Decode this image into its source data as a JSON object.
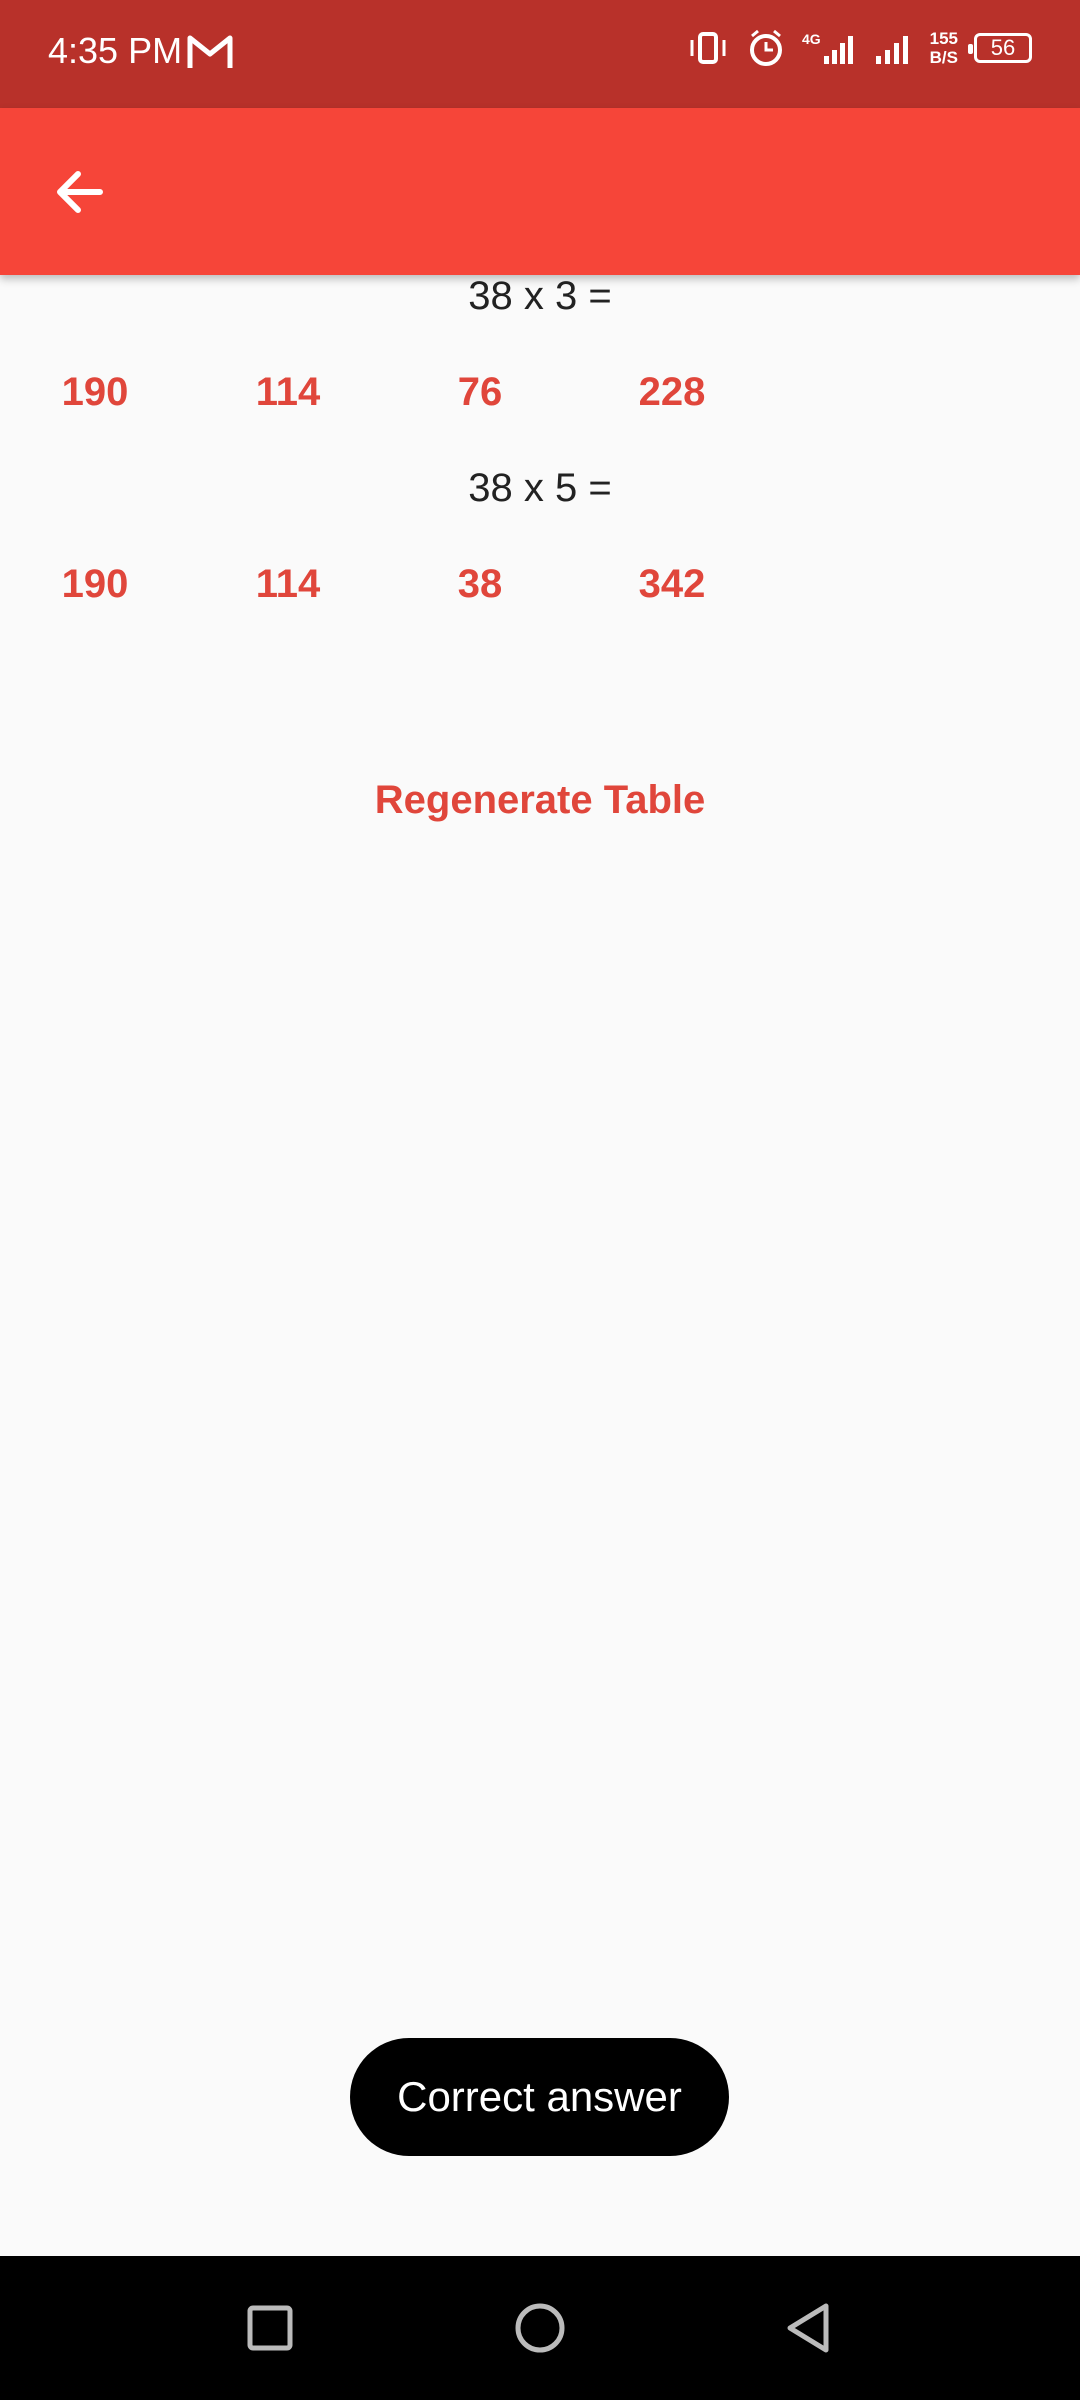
{
  "status_bar": {
    "time": "4:35 PM",
    "speed_top": "155",
    "speed_bottom": "B/S",
    "battery": "56",
    "icons": [
      "gmail-icon",
      "vibrate-icon",
      "alarm-icon",
      "signal-4g-icon",
      "signal-icon"
    ]
  },
  "app_bar": {
    "back_icon": "arrow-back-icon",
    "color": "#f64539"
  },
  "questions": [
    {
      "text": "38 x 3 =",
      "options": [
        "190",
        "114",
        "76",
        "228"
      ]
    },
    {
      "text": "38 x 5 =",
      "options": [
        "190",
        "114",
        "38",
        "342"
      ]
    }
  ],
  "regenerate_label": "Regenerate Table",
  "toast": "Correct answer",
  "nav_bar": {
    "icons": [
      "recent-apps-icon",
      "home-icon",
      "back-nav-icon"
    ]
  },
  "colors": {
    "accent": "#e0463b",
    "status_bar": "#b8312a"
  }
}
